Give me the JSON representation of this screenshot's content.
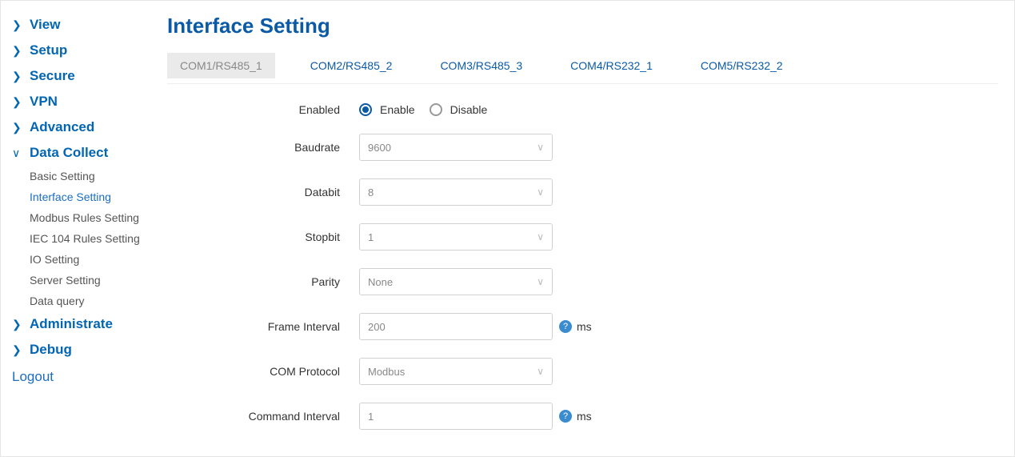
{
  "sidebar": {
    "items": [
      {
        "label": "View",
        "expanded": false
      },
      {
        "label": "Setup",
        "expanded": false
      },
      {
        "label": "Secure",
        "expanded": false
      },
      {
        "label": "VPN",
        "expanded": false
      },
      {
        "label": "Advanced",
        "expanded": false
      },
      {
        "label": "Data Collect",
        "expanded": true
      },
      {
        "label": "Administrate",
        "expanded": false
      },
      {
        "label": "Debug",
        "expanded": false
      }
    ],
    "data_collect_sub": [
      "Basic Setting",
      "Interface Setting",
      "Modbus Rules Setting",
      "IEC 104 Rules Setting",
      "IO Setting",
      "Server Setting",
      "Data query"
    ],
    "logout": "Logout"
  },
  "page": {
    "title": "Interface Setting"
  },
  "tabs": [
    "COM1/RS485_1",
    "COM2/RS485_2",
    "COM3/RS485_3",
    "COM4/RS232_1",
    "COM5/RS232_2"
  ],
  "form": {
    "enabled_label": "Enabled",
    "enable_option": "Enable",
    "disable_option": "Disable",
    "baudrate_label": "Baudrate",
    "baudrate_value": "9600",
    "databit_label": "Databit",
    "databit_value": "8",
    "stopbit_label": "Stopbit",
    "stopbit_value": "1",
    "parity_label": "Parity",
    "parity_value": "None",
    "frame_interval_label": "Frame Interval",
    "frame_interval_value": "200",
    "frame_interval_unit": "ms",
    "com_protocol_label": "COM Protocol",
    "com_protocol_value": "Modbus",
    "command_interval_label": "Command Interval",
    "command_interval_value": "1",
    "command_interval_unit": "ms",
    "help_glyph": "?"
  }
}
